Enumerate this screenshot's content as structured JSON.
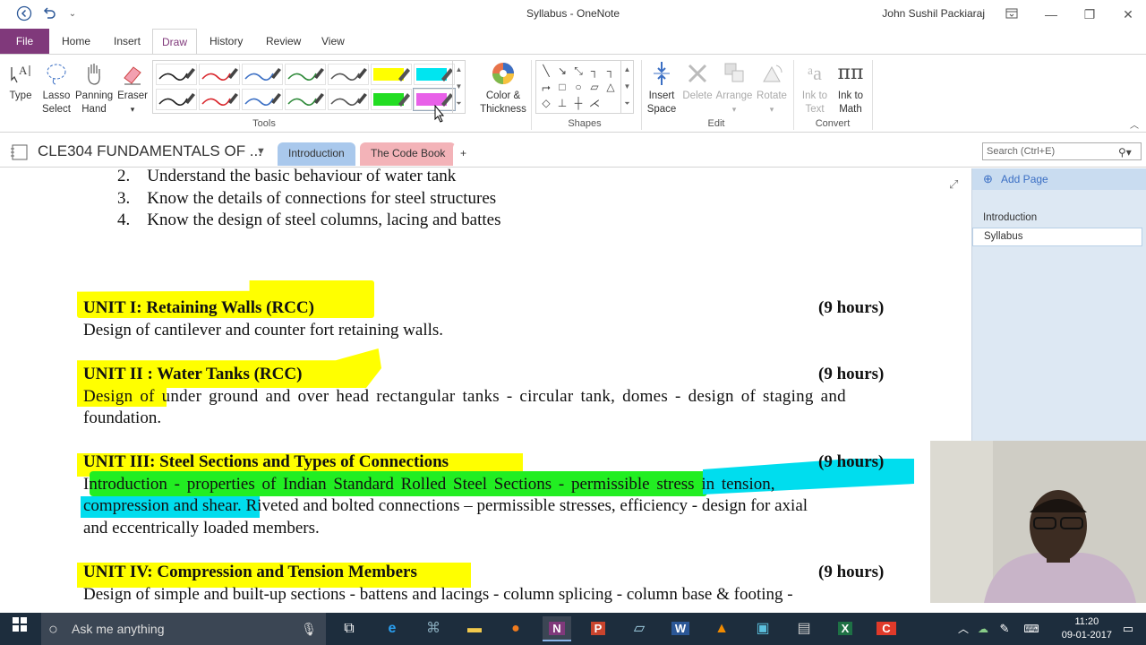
{
  "window": {
    "title": "Syllabus  -  OneNote",
    "user": "John Sushil Packiaraj"
  },
  "tabs": [
    "File",
    "Home",
    "Insert",
    "Draw",
    "History",
    "Review",
    "View"
  ],
  "ribbon": {
    "type": "Type",
    "lasso": [
      "Lasso",
      "Select"
    ],
    "panning": [
      "Panning",
      "Hand"
    ],
    "eraser": "Eraser",
    "tools_label": "Tools",
    "color": [
      "Color &",
      "Thickness"
    ],
    "shapes_label": "Shapes",
    "insert_space": [
      "Insert",
      "Space"
    ],
    "delete": "Delete",
    "arrange": "Arrange",
    "rotate": "Rotate",
    "edit_label": "Edit",
    "ink_text": [
      "Ink to",
      "Text"
    ],
    "ink_math": [
      "Ink to",
      "Math"
    ],
    "convert_label": "Convert",
    "pen_colors": [
      "#222222",
      "#d9262c",
      "#3b6fc4",
      "#2f8a3a",
      "#555555",
      "#ffff00",
      "#00e5f0",
      "#222222",
      "#d9262c",
      "#3b6fc4",
      "#2f8a3a",
      "#555555",
      "#22dd22",
      "#e860e8"
    ]
  },
  "notebook": {
    "title": "CLE304 FUNDAMENTALS OF ...",
    "sections": [
      "Introduction",
      "The Code Book",
      "+"
    ],
    "search_placeholder": "Search (Ctrl+E)"
  },
  "pages_pane": {
    "add_page": "Add Page",
    "pages": [
      "Introduction",
      "Syllabus"
    ]
  },
  "document": {
    "list": [
      {
        "n": "2.",
        "text": "Understand the basic behaviour of water tank"
      },
      {
        "n": "3.",
        "text": "Know the details of connections for steel structures"
      },
      {
        "n": "4.",
        "text": "Know the design of steel columns, lacing and battes"
      }
    ],
    "units": [
      {
        "title": "UNIT I:  Retaining Walls (RCC)",
        "hours": "(9 hours)",
        "body": [
          "Design of cantilever and counter fort retaining walls."
        ]
      },
      {
        "title": "UNIT II : Water Tanks (RCC)",
        "hours": "(9 hours)",
        "body": [
          "Design of under ground and over head rectangular tanks - circular tank, domes - design of staging and",
          "foundation."
        ]
      },
      {
        "title": "UNIT III: Steel Sections and Types of Connections",
        "hours": "(9 hours)",
        "body": [
          "Introduction - properties of Indian Standard Rolled Steel Sections - permissible stress in tension,",
          "compression and shear. Riveted and bolted connections – permissible stresses, efficiency - design for axial",
          "and eccentrically loaded members."
        ]
      },
      {
        "title": "UNIT IV: Compression and Tension Members",
        "hours": "(9 hours)",
        "body": [
          "Design of simple and built-up sections - battens and lacings - column splicing - column base & footing -"
        ]
      }
    ]
  },
  "taskbar": {
    "search": "Ask me anything",
    "time": "11:20",
    "date": "09-01-2017"
  }
}
